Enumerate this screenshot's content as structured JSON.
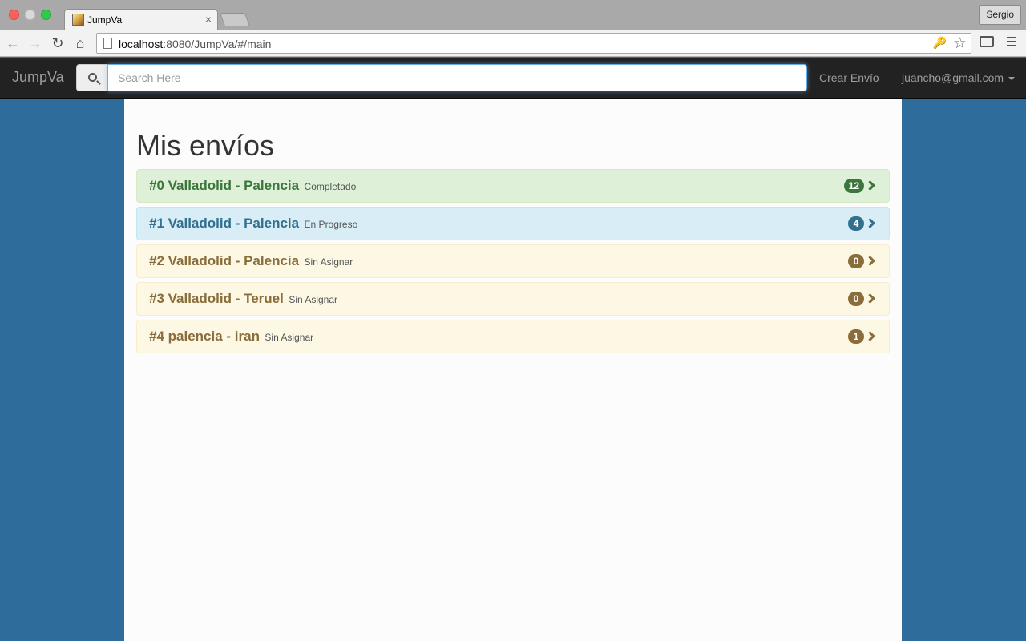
{
  "browser": {
    "tab_title": "JumpVa",
    "tab_close": "×",
    "profile": "Sergio",
    "url_host": "localhost",
    "url_rest": ":8080/JumpVa/#/main",
    "icons": [
      "back-icon",
      "forward-icon",
      "reload-icon",
      "home-icon",
      "page-icon",
      "key-icon",
      "star-icon",
      "cast-icon",
      "menu-icon"
    ]
  },
  "navbar": {
    "brand": "JumpVa",
    "search_placeholder": "Search Here",
    "create_link": "Crear Envío",
    "user_email": "juancho@gmail.com"
  },
  "main": {
    "title": "Mis envíos",
    "shipments": [
      {
        "route": "#0 Valladolid - Palencia",
        "status": "Completado",
        "count": "12",
        "style": "success"
      },
      {
        "route": "#1 Valladolid - Palencia",
        "status": "En Progreso",
        "count": "4",
        "style": "info"
      },
      {
        "route": "#2 Valladolid - Palencia",
        "status": "Sin Asignar",
        "count": "0",
        "style": "warning"
      },
      {
        "route": "#3 Valladolid - Teruel",
        "status": "Sin Asignar",
        "count": "0",
        "style": "warning"
      },
      {
        "route": "#4 palencia - iran",
        "status": "Sin Asignar",
        "count": "1",
        "style": "warning"
      }
    ]
  },
  "colors": {
    "page_bg": "#2e6c9b",
    "navbar_bg": "#222222",
    "success_bg": "#dff0d8",
    "info_bg": "#d9edf7",
    "warning_bg": "#fcf8e3"
  }
}
